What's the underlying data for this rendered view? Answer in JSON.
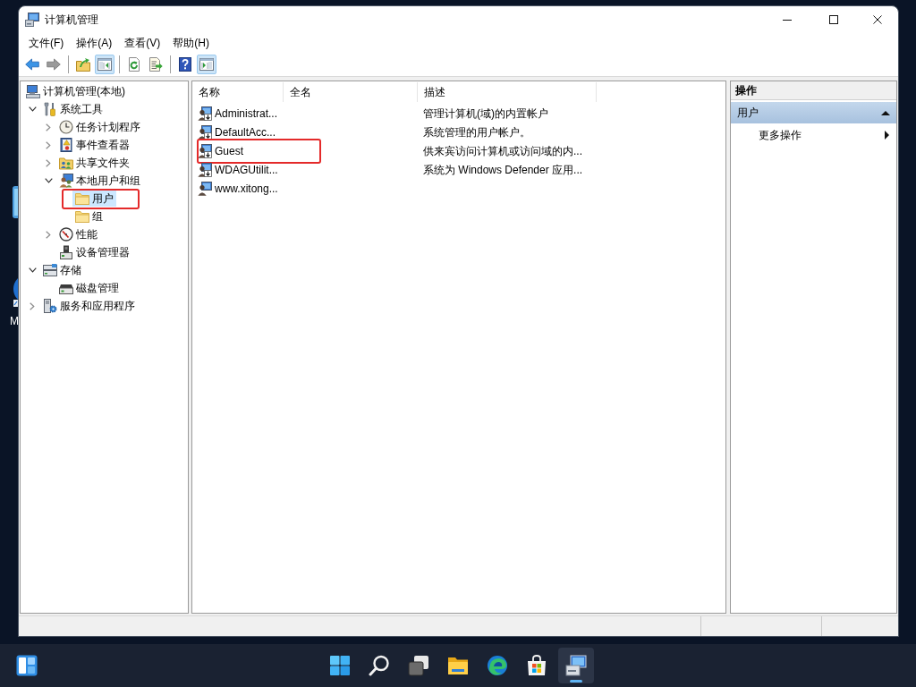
{
  "desktop": {
    "icons": [
      {
        "kind": "tile"
      },
      {
        "kind": "circle",
        "label": "M"
      }
    ]
  },
  "window": {
    "title": "计算机管理"
  },
  "menu": [
    "文件(F)",
    "操作(A)",
    "查看(V)",
    "帮助(H)"
  ],
  "toolbar": [
    {
      "kind": "back",
      "pressed": false,
      "disabled": false
    },
    {
      "kind": "forward",
      "pressed": false,
      "disabled": true
    },
    {
      "kind": "separator"
    },
    {
      "kind": "up",
      "pressed": false,
      "disabled": false
    },
    {
      "kind": "console-tree",
      "pressed": true,
      "disabled": false
    },
    {
      "kind": "separator"
    },
    {
      "kind": "refresh",
      "pressed": false,
      "disabled": false
    },
    {
      "kind": "export",
      "pressed": false,
      "disabled": false
    },
    {
      "kind": "separator"
    },
    {
      "kind": "help",
      "pressed": false,
      "disabled": false
    },
    {
      "kind": "action-pane",
      "pressed": true,
      "disabled": false
    }
  ],
  "tree": [
    {
      "label": "计算机管理(本地)",
      "kind": "computer",
      "selected": false,
      "annotated": false,
      "children": [
        {
          "label": "系统工具",
          "kind": "tools",
          "expanded": true,
          "selected": false,
          "annotated": false,
          "children": [
            {
              "label": "任务计划程序",
              "kind": "scheduler",
              "expanded": false,
              "selected": false,
              "annotated": false
            },
            {
              "label": "事件查看器",
              "kind": "event-log",
              "expanded": false,
              "selected": false,
              "annotated": false
            },
            {
              "label": "共享文件夹",
              "kind": "shared-folder",
              "expanded": false,
              "selected": false,
              "annotated": false
            },
            {
              "label": "本地用户和组",
              "kind": "users",
              "expanded": true,
              "selected": false,
              "annotated": false,
              "children": [
                {
                  "label": "用户",
                  "kind": "folder",
                  "selected": true,
                  "annotated": true
                },
                {
                  "label": "组",
                  "kind": "folder",
                  "selected": false,
                  "annotated": false
                }
              ]
            },
            {
              "label": "性能",
              "kind": "performance",
              "expanded": false,
              "selected": false,
              "annotated": false
            },
            {
              "label": "设备管理器",
              "kind": "device",
              "selected": false,
              "annotated": false
            }
          ]
        },
        {
          "label": "存储",
          "kind": "storage",
          "expanded": true,
          "selected": false,
          "annotated": false,
          "children": [
            {
              "label": "磁盘管理",
              "kind": "disk",
              "selected": false,
              "annotated": false
            }
          ]
        },
        {
          "label": "服务和应用程序",
          "kind": "services",
          "expanded": false,
          "selected": false,
          "annotated": false
        }
      ]
    }
  ],
  "list": {
    "columns": [
      "名称",
      "全名",
      "描述"
    ],
    "rows": [
      {
        "name": "Administrat...",
        "description": "管理计算机(域)的内置帐户",
        "disabled": true,
        "selected": false,
        "annotated": false
      },
      {
        "name": "DefaultAcc...",
        "description": "系统管理的用户帐户。",
        "disabled": true,
        "selected": false,
        "annotated": false
      },
      {
        "name": "Guest",
        "description": "供来宾访问计算机或访问域的内...",
        "disabled": true,
        "selected": false,
        "annotated": true
      },
      {
        "name": "WDAGUtilit...",
        "description": "系统为 Windows Defender 应用...",
        "disabled": true,
        "selected": false,
        "annotated": false
      },
      {
        "name": "www.xitong...",
        "disabled": false,
        "selected": false,
        "annotated": false
      }
    ]
  },
  "actions": {
    "title": "操作",
    "sections": [
      {
        "label": "用户",
        "expanded": true,
        "items": [
          {
            "label": "更多操作",
            "submenu": true
          }
        ]
      }
    ]
  },
  "taskbar": {
    "left": [
      {
        "kind": "widgets",
        "active": false
      }
    ],
    "center": [
      {
        "kind": "start",
        "active": false
      },
      {
        "kind": "search",
        "active": false
      },
      {
        "kind": "task-view",
        "active": false
      },
      {
        "kind": "file-explorer",
        "active": false
      },
      {
        "kind": "browser",
        "active": false
      },
      {
        "kind": "store",
        "active": false
      },
      {
        "kind": "computer-management",
        "active": true
      }
    ]
  }
}
